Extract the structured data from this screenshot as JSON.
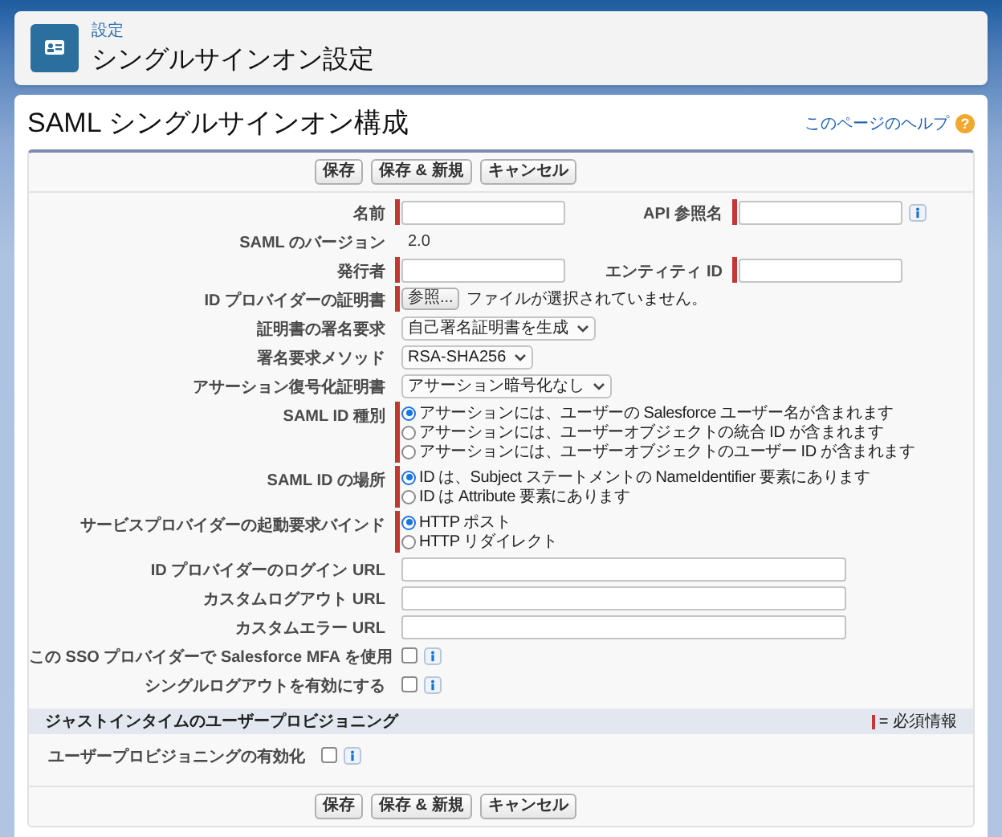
{
  "header": {
    "breadcrumb": "設定",
    "title": "シングルサインオン設定"
  },
  "page": {
    "title": "SAML シングルサインオン構成",
    "help_link": "このページのヘルプ",
    "help_badge": "?"
  },
  "top_buttons": [
    "保存",
    "保存 & 新規",
    "キャンセル"
  ],
  "form_rows": [
    {
      "cells": [
        {
          "label": "名前",
          "kind": "text",
          "required": true
        },
        {
          "label": "API 参照名",
          "kind": "text",
          "required": true,
          "info": true
        }
      ]
    },
    {
      "cells": [
        {
          "label": "SAML のバージョン",
          "kind": "static",
          "value": "2.0"
        }
      ]
    },
    {
      "cells": [
        {
          "label": "発行者",
          "kind": "text",
          "required": true
        },
        {
          "label": "エンティティ ID",
          "kind": "text",
          "required": true
        }
      ]
    },
    {
      "cells": [
        {
          "label": "ID プロバイダーの証明書",
          "kind": "file",
          "required": true,
          "button": "参照...",
          "status": "ファイルが選択されていません。"
        }
      ]
    },
    {
      "cells": [
        {
          "label": "証明書の署名要求",
          "kind": "select",
          "value": "自己署名証明書を生成"
        }
      ]
    },
    {
      "cells": [
        {
          "label": "署名要求メソッド",
          "kind": "select",
          "value": "RSA-SHA256"
        }
      ]
    },
    {
      "cells": [
        {
          "label": "アサーション復号化証明書",
          "kind": "select",
          "value": "アサーション暗号化なし"
        }
      ]
    },
    {
      "cells": [
        {
          "label": "SAML ID 種別",
          "kind": "radio",
          "required": true,
          "options": [
            {
              "label": "アサーションには、ユーザーの Salesforce ユーザー名が含まれます",
              "selected": true
            },
            {
              "label": "アサーションには、ユーザーオブジェクトの統合 ID が含まれます",
              "selected": false
            },
            {
              "label": "アサーションには、ユーザーオブジェクトのユーザー ID が含まれます",
              "selected": false
            }
          ]
        }
      ]
    },
    {
      "cells": [
        {
          "label": "SAML ID の場所",
          "kind": "radio",
          "required": true,
          "options": [
            {
              "label": "ID は、Subject ステートメントの NameIdentifier 要素にあります",
              "selected": true
            },
            {
              "label": "ID は Attribute 要素にあります",
              "selected": false
            }
          ]
        }
      ]
    },
    {
      "cells": [
        {
          "label": "サービスプロバイダーの起動要求バインド",
          "kind": "radio",
          "required": true,
          "options": [
            {
              "label": "HTTP ポスト",
              "selected": true
            },
            {
              "label": "HTTP リダイレクト",
              "selected": false
            }
          ]
        }
      ]
    },
    {
      "cells": [
        {
          "label": "ID プロバイダーのログイン URL",
          "kind": "url"
        }
      ]
    },
    {
      "cells": [
        {
          "label": "カスタムログアウト URL",
          "kind": "url"
        }
      ]
    },
    {
      "cells": [
        {
          "label": "カスタムエラー URL",
          "kind": "url"
        }
      ]
    },
    {
      "cells": [
        {
          "label": "この SSO プロバイダーで Salesforce MFA を使用",
          "kind": "checkbox",
          "checked": false,
          "info": true
        }
      ]
    },
    {
      "cells": [
        {
          "label": "シングルログアウトを有効にする",
          "kind": "checkbox",
          "checked": false,
          "info": true
        }
      ]
    }
  ],
  "section": {
    "title": "ジャストインタイムのユーザープロビジョニング",
    "required_legend": "= 必須情報",
    "rows": [
      {
        "cells": [
          {
            "label": "ユーザープロビジョニングの有効化",
            "kind": "checkbox",
            "checked": false,
            "info": true
          }
        ]
      }
    ]
  },
  "bottom_buttons": [
    "保存",
    "保存 & 新規",
    "キャンセル"
  ]
}
